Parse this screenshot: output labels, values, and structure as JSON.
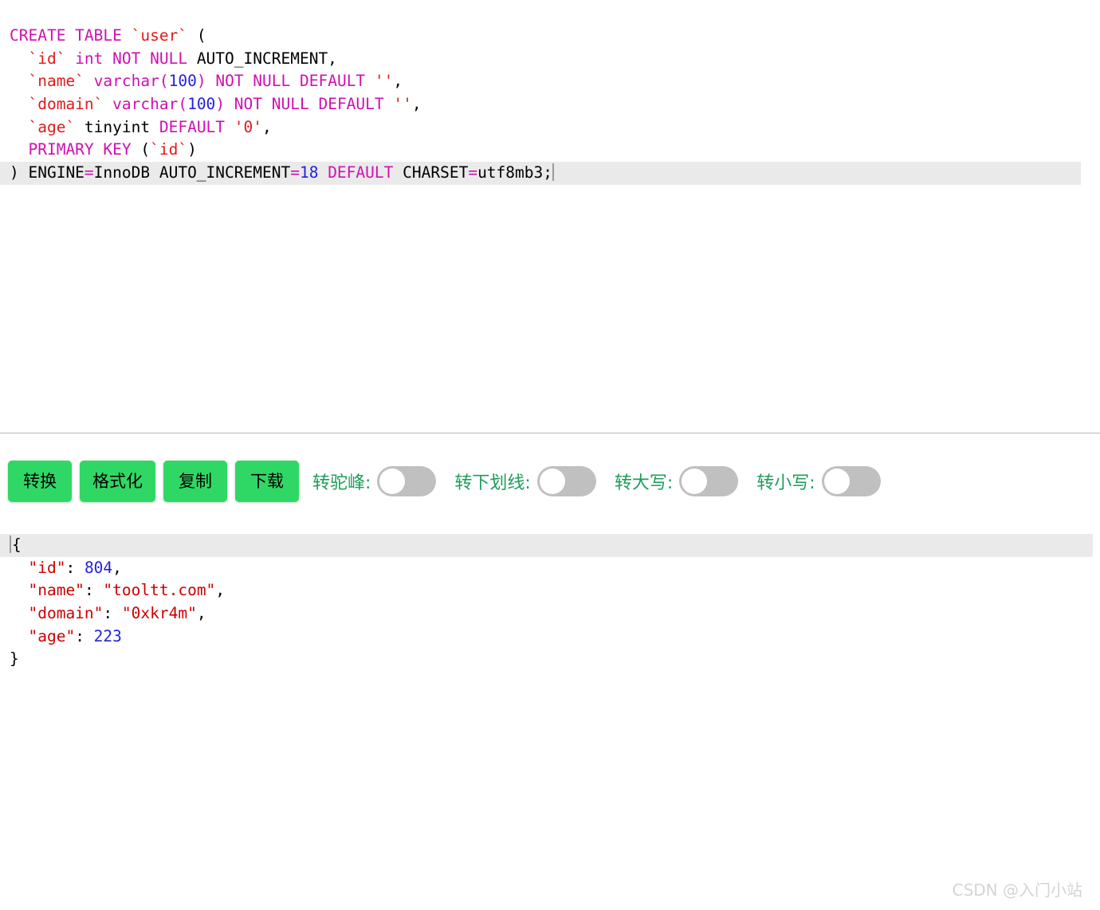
{
  "sql_editor": {
    "name": "SQL DDL input editor",
    "active_line_index": 6,
    "lines": [
      {
        "segments": [
          {
            "text": "CREATE TABLE ",
            "type": "kw"
          },
          {
            "text": "`user`",
            "type": "id"
          },
          {
            "text": " (",
            "type": "txt"
          }
        ]
      },
      {
        "segments": [
          {
            "text": "  ",
            "type": "txt"
          },
          {
            "text": "`id`",
            "type": "id"
          },
          {
            "text": " int NOT NULL",
            "type": "kw"
          },
          {
            "text": " AUTO_INCREMENT,",
            "type": "txt"
          }
        ]
      },
      {
        "segments": [
          {
            "text": "  ",
            "type": "txt"
          },
          {
            "text": "`name`",
            "type": "id"
          },
          {
            "text": " varchar(",
            "type": "kw"
          },
          {
            "text": "100",
            "type": "num"
          },
          {
            "text": ")",
            "type": "kw"
          },
          {
            "text": " NOT NULL DEFAULT ",
            "type": "kw"
          },
          {
            "text": "''",
            "type": "str"
          },
          {
            "text": ",",
            "type": "txt"
          }
        ]
      },
      {
        "segments": [
          {
            "text": "  ",
            "type": "txt"
          },
          {
            "text": "`domain`",
            "type": "id"
          },
          {
            "text": " varchar(",
            "type": "kw"
          },
          {
            "text": "100",
            "type": "num"
          },
          {
            "text": ")",
            "type": "kw"
          },
          {
            "text": " NOT NULL DEFAULT ",
            "type": "kw"
          },
          {
            "text": "''",
            "type": "str"
          },
          {
            "text": ",",
            "type": "txt"
          }
        ]
      },
      {
        "segments": [
          {
            "text": "  ",
            "type": "txt"
          },
          {
            "text": "`age`",
            "type": "id"
          },
          {
            "text": " tinyint ",
            "type": "txt"
          },
          {
            "text": "DEFAULT ",
            "type": "kw"
          },
          {
            "text": "'0'",
            "type": "str"
          },
          {
            "text": ",",
            "type": "txt"
          }
        ]
      },
      {
        "segments": [
          {
            "text": "  ",
            "type": "txt"
          },
          {
            "text": "PRIMARY KEY",
            "type": "kw"
          },
          {
            "text": " (",
            "type": "txt"
          },
          {
            "text": "`id`",
            "type": "id"
          },
          {
            "text": ")",
            "type": "txt"
          }
        ]
      },
      {
        "segments": [
          {
            "text": ") ENGINE",
            "type": "txt"
          },
          {
            "text": "=",
            "type": "kw"
          },
          {
            "text": "InnoDB AUTO_INCREMENT",
            "type": "txt"
          },
          {
            "text": "=",
            "type": "kw"
          },
          {
            "text": "18",
            "type": "num"
          },
          {
            "text": " DEFAULT ",
            "type": "kw"
          },
          {
            "text": "CHARSET",
            "type": "txt"
          },
          {
            "text": "=",
            "type": "kw"
          },
          {
            "text": "utf8mb3;",
            "type": "txt"
          }
        ],
        "caret_after": true
      }
    ]
  },
  "toolbar": {
    "buttons": [
      {
        "label": "转换",
        "name": "convert-button"
      },
      {
        "label": "格式化",
        "name": "format-button"
      },
      {
        "label": "复制",
        "name": "copy-button"
      },
      {
        "label": "下载",
        "name": "download-button"
      }
    ],
    "toggles": [
      {
        "label": "转驼峰:",
        "name": "camel-case-toggle",
        "on": false
      },
      {
        "label": "转下划线:",
        "name": "snake-case-toggle",
        "on": false
      },
      {
        "label": "转大写:",
        "name": "uppercase-toggle",
        "on": false
      },
      {
        "label": "转小写:",
        "name": "lowercase-toggle",
        "on": false
      }
    ],
    "button_color": "#2fd865",
    "label_color": "#1d9e59",
    "switch_off_color": "#c0c0c0"
  },
  "json_editor": {
    "name": "JSON output editor",
    "active_line_index": 0,
    "lines": [
      {
        "caret_before": true,
        "segments": [
          {
            "text": "{",
            "type": "punc"
          }
        ]
      },
      {
        "segments": [
          {
            "text": "  ",
            "type": "punc"
          },
          {
            "text": "\"id\"",
            "type": "key"
          },
          {
            "text": ": ",
            "type": "punc"
          },
          {
            "text": "804",
            "type": "nval"
          },
          {
            "text": ",",
            "type": "punc"
          }
        ]
      },
      {
        "segments": [
          {
            "text": "  ",
            "type": "punc"
          },
          {
            "text": "\"name\"",
            "type": "key"
          },
          {
            "text": ": ",
            "type": "punc"
          },
          {
            "text": "\"tooltt.com\"",
            "type": "sval"
          },
          {
            "text": ",",
            "type": "punc"
          }
        ]
      },
      {
        "segments": [
          {
            "text": "  ",
            "type": "punc"
          },
          {
            "text": "\"domain\"",
            "type": "key"
          },
          {
            "text": ": ",
            "type": "punc"
          },
          {
            "text": "\"0xkr4m\"",
            "type": "sval"
          },
          {
            "text": ",",
            "type": "punc"
          }
        ]
      },
      {
        "segments": [
          {
            "text": "  ",
            "type": "punc"
          },
          {
            "text": "\"age\"",
            "type": "key"
          },
          {
            "text": ": ",
            "type": "punc"
          },
          {
            "text": "223",
            "type": "nval"
          }
        ]
      },
      {
        "segments": [
          {
            "text": "}",
            "type": "punc"
          }
        ]
      }
    ],
    "values": {
      "id": 804,
      "name": "tooltt.com",
      "domain": "0xkr4m",
      "age": 223
    }
  },
  "watermark": {
    "text": "CSDN @入门小站"
  }
}
